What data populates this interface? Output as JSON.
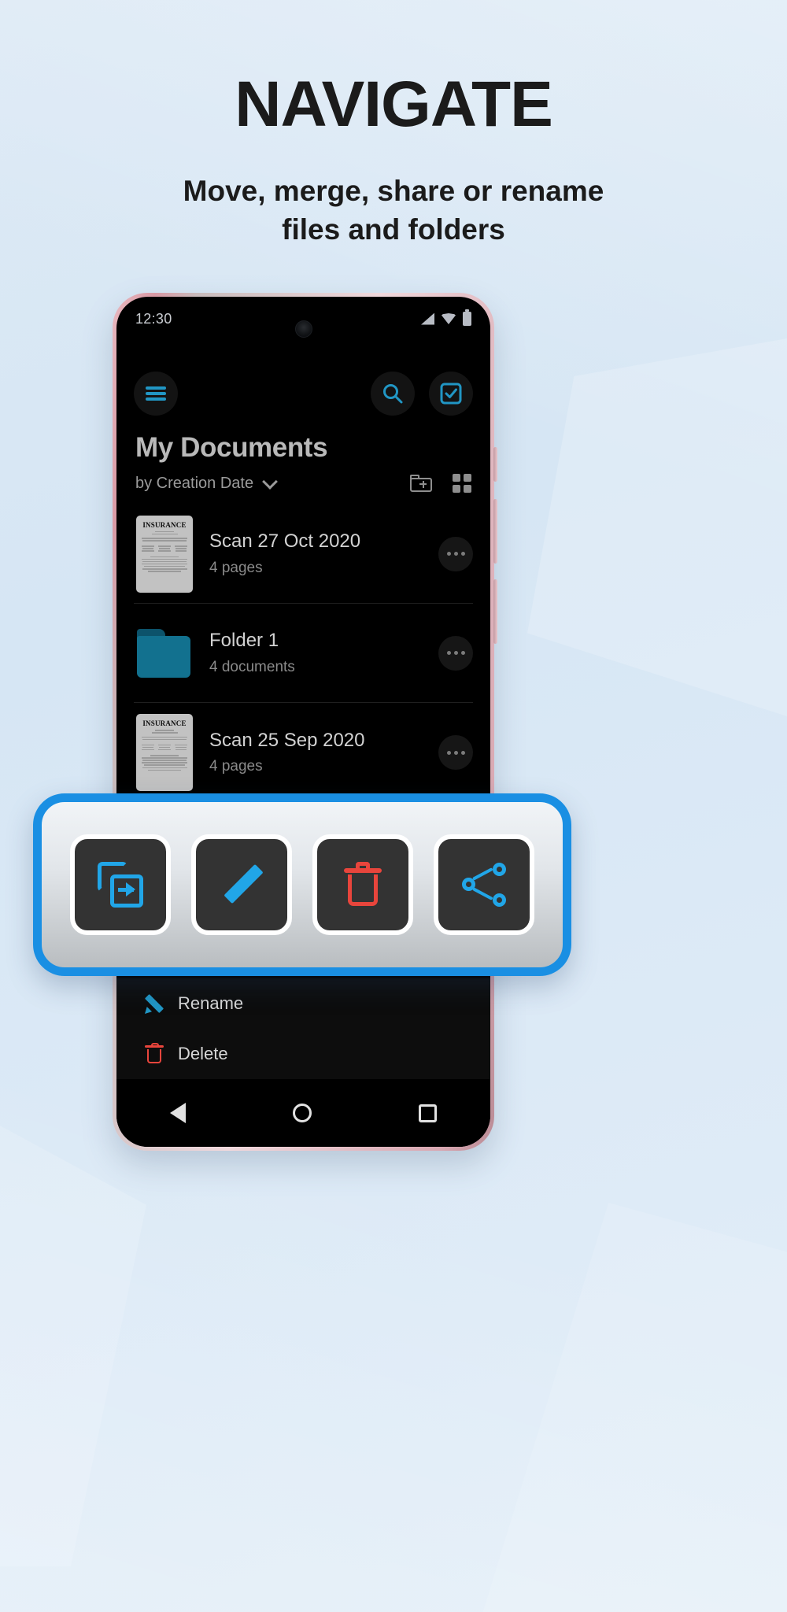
{
  "promo": {
    "headline": "NAVIGATE",
    "subhead_line1": "Move, merge, share or rename",
    "subhead_line2": "files and folders"
  },
  "colors": {
    "background": "#dce9f5",
    "accent_blue": "#1a8fe3",
    "icon_cyan": "#21a6e8",
    "danger_red": "#e8453c",
    "folder_teal": "#12718f",
    "phone_frame": "#e8b9c0"
  },
  "phone": {
    "statusbar": {
      "time": "12:30",
      "icons": [
        "signal-icon",
        "wifi-icon",
        "battery-icon"
      ],
      "camera": "front-camera"
    },
    "toolbar": {
      "menu_icon": "hamburger-menu-icon",
      "search_icon": "search-icon",
      "select_icon": "select-all-checkbox-icon"
    },
    "header": {
      "title": "My Documents",
      "sort_label": "by Creation Date",
      "sort_chevron": "chevron-down-icon",
      "new_folder_icon": "new-folder-icon",
      "grid_view_icon": "grid-view-icon"
    },
    "files": [
      {
        "type": "document",
        "name": "Scan 27 Oct 2020",
        "meta": "4 pages",
        "thumb_header": "INSURANCE",
        "overflow_icon": "overflow-menu-icon"
      },
      {
        "type": "folder",
        "name": "Folder 1",
        "meta": "4 documents",
        "thumb_header": "",
        "overflow_icon": "overflow-menu-icon"
      },
      {
        "type": "document",
        "name": "Scan 25 Sep 2020",
        "meta": "4 pages",
        "thumb_header": "INSURANCE",
        "overflow_icon": "overflow-menu-icon"
      }
    ],
    "context_menu": [
      {
        "label": "Rename",
        "icon": "pencil-icon"
      },
      {
        "label": "Delete",
        "icon": "trash-icon"
      }
    ],
    "navbar": {
      "back": "back-triangle-icon",
      "home": "home-circle-icon",
      "recents": "recents-square-icon"
    }
  },
  "callout": {
    "actions": [
      {
        "name": "merge",
        "icon": "merge-documents-icon"
      },
      {
        "name": "rename",
        "icon": "pencil-icon"
      },
      {
        "name": "delete",
        "icon": "trash-icon"
      },
      {
        "name": "share",
        "icon": "share-icon"
      }
    ]
  }
}
